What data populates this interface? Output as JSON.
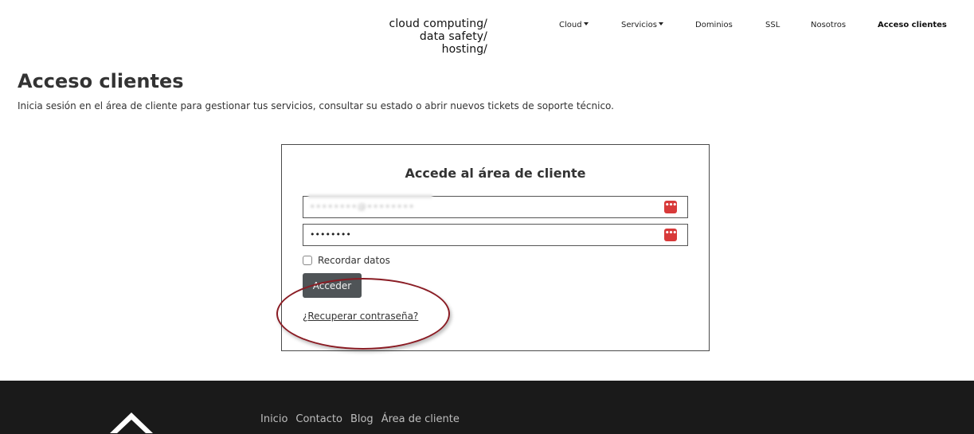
{
  "header": {
    "tagline": [
      "cloud computing/",
      "data safety/",
      "hosting/"
    ],
    "nav": [
      {
        "label": "Cloud",
        "dropdown": true,
        "active": false
      },
      {
        "label": "Servicios",
        "dropdown": true,
        "active": false
      },
      {
        "label": "Dominios",
        "dropdown": false,
        "active": false
      },
      {
        "label": "SSL",
        "dropdown": false,
        "active": false
      },
      {
        "label": "Nosotros",
        "dropdown": false,
        "active": false
      },
      {
        "label": "Acceso clientes",
        "dropdown": false,
        "active": true
      }
    ]
  },
  "page": {
    "title": "Acceso clientes",
    "description": "Inicia sesión en el área de cliente para gestionar tus servicios, consultar su estado o abrir nuevos tickets de soporte técnico."
  },
  "login": {
    "title": "Accede al área de cliente",
    "username_value": "••••••••@••••••••",
    "password_value": "••••••••",
    "password_manager_icon": "password-manager-icon",
    "remember_label": "Recordar datos",
    "remember_checked": false,
    "submit_label": "Acceder",
    "forgot_label": "¿Recuperar contraseña?"
  },
  "annotation": {
    "color": "#8a1c24",
    "target": "forgot-password-link"
  },
  "footer": {
    "links": [
      "Inicio",
      "Contacto",
      "Blog",
      "Área de cliente"
    ]
  },
  "colors": {
    "button_bg": "#4f5457",
    "footer_bg": "#1a1a1a",
    "pm_icon": "#d83a3a"
  }
}
